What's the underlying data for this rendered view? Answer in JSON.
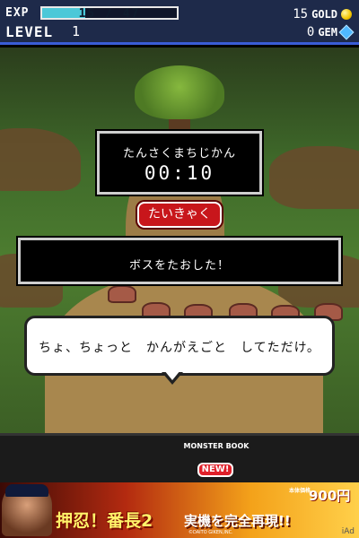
{
  "hud": {
    "exp_label": "EXP",
    "exp_text": "15 / 47",
    "exp_fill_fraction": 0.319,
    "level_label": "LEVEL",
    "level_value": "1",
    "gold_value": "15",
    "gold_unit": "GOLD",
    "gem_value": "0",
    "gem_unit": "GEM",
    "gold_icon": "coin-icon",
    "gem_icon": "diamond-icon"
  },
  "timer": {
    "title": "たんさくまちじかん",
    "value": "00:10"
  },
  "retreat_button": {
    "label": "たいきゃく"
  },
  "message": {
    "text": "ボスをたおした！"
  },
  "speech": {
    "text": "ちょ、ちょっと　かんがえごと　してただけ。"
  },
  "bottom_menu": {
    "monster_book_title": "MONSTER BOOK",
    "new_badge": "NEW!"
  },
  "ad": {
    "title": "押忍！番長2",
    "price_label": "本体価格",
    "price": "900円",
    "tagline": "実機を完全再現!!",
    "copyright": "©DAITO GIKEN,INC.",
    "network_label": "iAd"
  },
  "colors": {
    "hud_background": "#1e2a4a",
    "exp_fill": "#4cc8d8",
    "retreat_button": "#c8161b",
    "new_badge": "#e0202a"
  }
}
